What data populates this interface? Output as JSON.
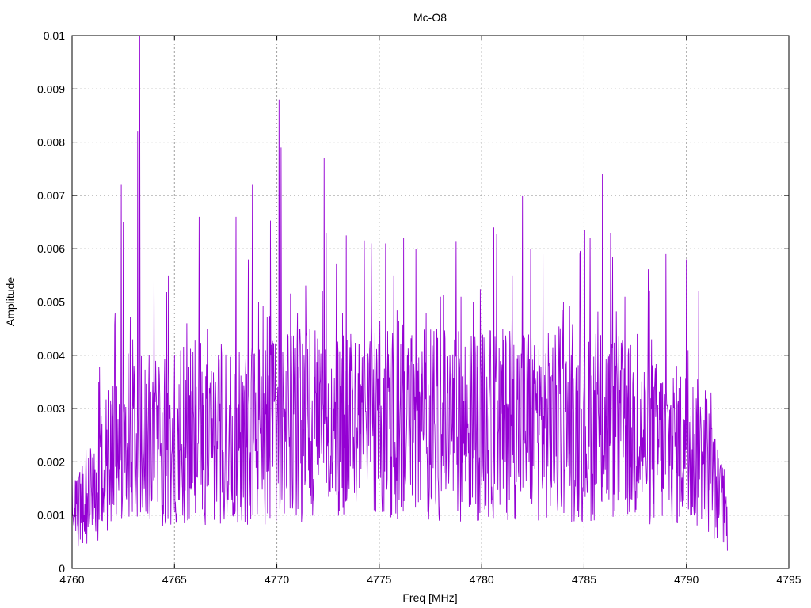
{
  "chart_data": {
    "type": "line",
    "title": "Mc-O8",
    "xlabel": "Freq [MHz]",
    "ylabel": "Amplitude",
    "xlim": [
      4760,
      4795
    ],
    "ylim": [
      0,
      0.01
    ],
    "x_ticks": [
      "4760",
      "4765",
      "4770",
      "4775",
      "4780",
      "4785",
      "4790",
      "4795"
    ],
    "y_ticks": [
      "0",
      "0.001",
      "0.002",
      "0.003",
      "0.004",
      "0.005",
      "0.006",
      "0.007",
      "0.008",
      "0.009",
      "0.01"
    ],
    "grid": true,
    "legend": "none",
    "series": [
      {
        "color": "#9400d3",
        "x_range": [
          4760,
          4792
        ],
        "samples": 1600,
        "baseline": [
          [
            4760.0,
            0.0012
          ],
          [
            4761.0,
            0.0014
          ],
          [
            4762.0,
            0.0022
          ],
          [
            4763.0,
            0.0026
          ],
          [
            4764.0,
            0.0024
          ],
          [
            4765.0,
            0.0024
          ],
          [
            4766.0,
            0.0026
          ],
          [
            4767.0,
            0.0024
          ],
          [
            4768.0,
            0.0025
          ],
          [
            4769.0,
            0.0025
          ],
          [
            4770.0,
            0.0026
          ],
          [
            4771.0,
            0.0027
          ],
          [
            4772.0,
            0.0026
          ],
          [
            4773.0,
            0.0026
          ],
          [
            4774.0,
            0.0027
          ],
          [
            4775.0,
            0.0028
          ],
          [
            4776.0,
            0.0028
          ],
          [
            4777.0,
            0.0028
          ],
          [
            4778.0,
            0.0027
          ],
          [
            4779.0,
            0.0027
          ],
          [
            4780.0,
            0.0027
          ],
          [
            4781.0,
            0.0027
          ],
          [
            4782.0,
            0.0028
          ],
          [
            4783.0,
            0.0027
          ],
          [
            4784.0,
            0.0026
          ],
          [
            4785.0,
            0.0026
          ],
          [
            4786.0,
            0.0027
          ],
          [
            4787.0,
            0.0026
          ],
          [
            4788.0,
            0.0024
          ],
          [
            4789.0,
            0.0023
          ],
          [
            4790.0,
            0.0023
          ],
          [
            4791.0,
            0.002
          ],
          [
            4791.5,
            0.0014
          ],
          [
            4792.0,
            0.0009
          ]
        ],
        "peaks": [
          [
            4761.3,
            0.0035
          ],
          [
            4762.1,
            0.0048
          ],
          [
            4762.4,
            0.0072
          ],
          [
            4762.5,
            0.0065
          ],
          [
            4763.2,
            0.0082
          ],
          [
            4763.3,
            0.01
          ],
          [
            4764.0,
            0.0057
          ],
          [
            4764.7,
            0.0055
          ],
          [
            4765.6,
            0.0046
          ],
          [
            4766.2,
            0.0066
          ],
          [
            4766.6,
            0.0045
          ],
          [
            4767.3,
            0.004
          ],
          [
            4768.0,
            0.0066
          ],
          [
            4768.6,
            0.0058
          ],
          [
            4768.8,
            0.0072
          ],
          [
            4769.1,
            0.005
          ],
          [
            4770.1,
            0.0088
          ],
          [
            4770.2,
            0.0079
          ],
          [
            4771.0,
            0.0048
          ],
          [
            4771.6,
            0.0045
          ],
          [
            4772.3,
            0.0077
          ],
          [
            4772.4,
            0.0063
          ],
          [
            4773.2,
            0.0048
          ],
          [
            4773.6,
            0.0044
          ],
          [
            4774.6,
            0.0061
          ],
          [
            4775.3,
            0.0061
          ],
          [
            4775.7,
            0.0055
          ],
          [
            4776.2,
            0.0062
          ],
          [
            4776.8,
            0.006
          ],
          [
            4777.3,
            0.0048
          ],
          [
            4778.0,
            0.0051
          ],
          [
            4779.0,
            0.0051
          ],
          [
            4779.6,
            0.005
          ],
          [
            4780.6,
            0.0064
          ],
          [
            4781.5,
            0.0055
          ],
          [
            4782.0,
            0.007
          ],
          [
            4782.4,
            0.006
          ],
          [
            4783.0,
            0.0059
          ],
          [
            4784.0,
            0.005
          ],
          [
            4784.8,
            0.0059
          ],
          [
            4785.3,
            0.0062
          ],
          [
            4785.9,
            0.0074
          ],
          [
            4786.3,
            0.0063
          ],
          [
            4787.0,
            0.0051
          ],
          [
            4787.6,
            0.0044
          ],
          [
            4788.3,
            0.0043
          ],
          [
            4789.0,
            0.0059
          ],
          [
            4790.0,
            0.0058
          ],
          [
            4790.6,
            0.0052
          ],
          [
            4791.2,
            0.0033
          ]
        ]
      }
    ]
  }
}
